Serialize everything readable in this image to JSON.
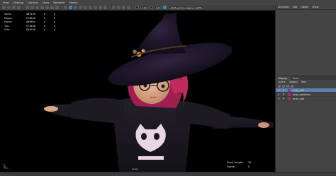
{
  "menubar": {
    "items": [
      "View",
      "Shading",
      "Lighting",
      "Show",
      "Renderer",
      "Panels"
    ]
  },
  "toolbar": {
    "value_a": "0.00",
    "value_b": "1.00",
    "colorspace": "sRGB gamma (legacy) (ACES)"
  },
  "hud": {
    "rows": [
      {
        "label": "Verts:",
        "v1": "487439",
        "v2": "0",
        "v3": "0"
      },
      {
        "label": "Edges:",
        "v1": "974846",
        "v2": "0",
        "v3": "0"
      },
      {
        "label": "Faces:",
        "v1": "485604",
        "v2": "0",
        "v3": "0"
      },
      {
        "label": "Tris:",
        "v1": "971838",
        "v2": "0",
        "v3": "0"
      },
      {
        "label": "UVs:",
        "v1": "563028",
        "v2": "0",
        "v3": "0"
      }
    ]
  },
  "viewport": {
    "camera_label": "persp",
    "focal_label": "Focal Length:",
    "focal_value": "35",
    "frame_label": "Frame:",
    "frame_value": "0"
  },
  "rpanel": {
    "menu": [
      "Channels",
      "Edit",
      "Object",
      "Show"
    ],
    "tabs": [
      "Display",
      "Anim"
    ],
    "layer_menu": [
      "Layers",
      "Options",
      "Help"
    ],
    "layers": [
      {
        "v": "V",
        "p": "P",
        "color": "#7b3fa0",
        "name": "bruja_ruth",
        "selected": true
      },
      {
        "v": "V",
        "p": "P",
        "color": "#a02a7a",
        "name": "bruja_sombrero",
        "selected": false
      },
      {
        "v": "V",
        "p": "P",
        "color": "#a02a7a",
        "name": "bruja_ojos",
        "selected": false
      }
    ]
  },
  "colors": {
    "background": "#000000",
    "selected_layer": "#5b7fae",
    "hat": "#1a1226",
    "hair": "#b8245a",
    "sweater": "#1c1820"
  }
}
